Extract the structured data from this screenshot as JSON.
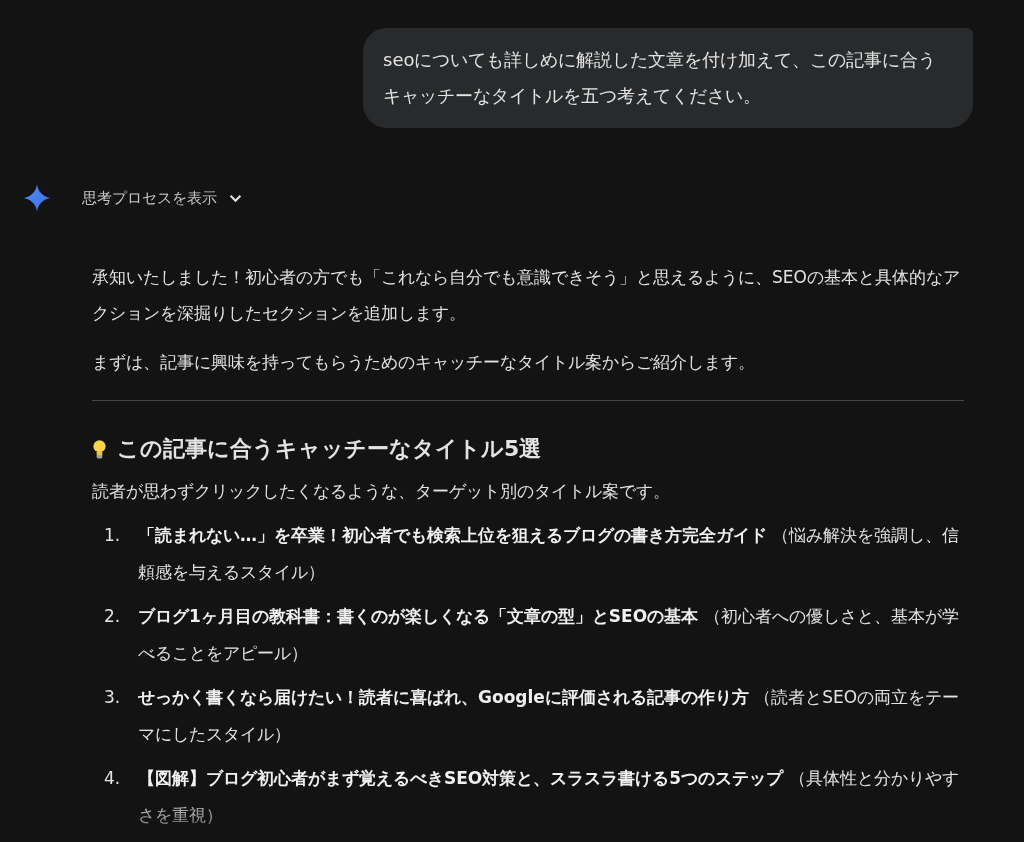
{
  "user_message": "seoについても詳しめに解説した文章を付け加えて、この記事に合うキャッチーなタイトルを五つ考えてください。",
  "thinking_toggle": {
    "label": "思考プロセスを表示",
    "expanded": false
  },
  "response": {
    "intro": [
      "承知いたしました！初心者の方でも「これなら自分でも意識できそう」と思えるように、SEOの基本と具体的なアクションを深掘りしたセクションを追加します。",
      "まずは、記事に興味を持ってもらうためのキャッチーなタイトル案からご紹介します。"
    ],
    "heading": "この記事に合うキャッチーなタイトル5選",
    "lead": "読者が思わずクリックしたくなるような、ターゲット別のタイトル案です。",
    "items": [
      {
        "number": "1.",
        "text": "**「読まれない…」を卒業！初心者でも検索上位を狙えるブログの書き方完全ガイド** （悩み解決を強調し、信頼感を与えるスタイル）"
      },
      {
        "number": "2.",
        "text": "**ブログ1ヶ月目の教科書：書くのが楽しくなる「文章の型」とSEOの基本** （初心者への優しさと、基本が学べることをアピール）"
      },
      {
        "number": "3.",
        "text": "**せっかく書くなら届けたい！読者に喜ばれ、Googleに評価される記事の作り方** （読者とSEOの両立をテーマにしたスタイル）"
      },
      {
        "number": "4.",
        "text": "**【図解】ブログ初心者がまず覚えるべきSEO対策と、スラスラ書ける5つのステップ** （具体性と分かりやすさを重視）"
      }
    ]
  }
}
